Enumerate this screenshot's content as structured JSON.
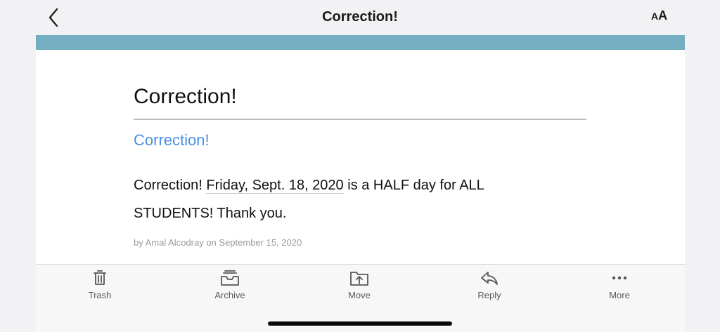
{
  "nav": {
    "title": "Correction!",
    "text_size_small": "A",
    "text_size_large": "A"
  },
  "colors": {
    "band": "#74aec0",
    "link": "#4a90e2"
  },
  "article": {
    "headline": "Correction!",
    "subhead": "Correction!",
    "body_prefix": "Correction! ",
    "body_date": "Friday, Sept. 18, 2020",
    "body_suffix": " is a HALF day for ALL STUDENTS! Thank you.",
    "byline": "by Amal Alcodray on September 15, 2020"
  },
  "toolbar": {
    "trash": "Trash",
    "archive": "Archive",
    "move": "Move",
    "reply": "Reply",
    "more": "More"
  }
}
